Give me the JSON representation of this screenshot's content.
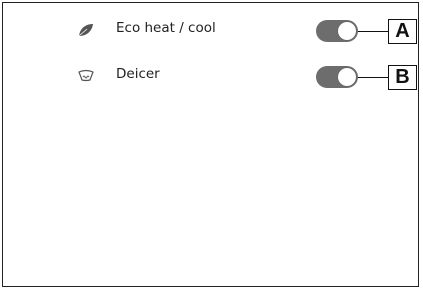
{
  "settings": {
    "eco": {
      "label": "Eco heat / cool",
      "icon": "leaf-icon",
      "toggle_state": "on",
      "callout": "A"
    },
    "deicer": {
      "label": "Deicer",
      "icon": "windshield-deicer-icon",
      "toggle_state": "on",
      "callout": "B"
    }
  },
  "colors": {
    "toggle_track": "#6d6d6d",
    "text": "#222222"
  }
}
